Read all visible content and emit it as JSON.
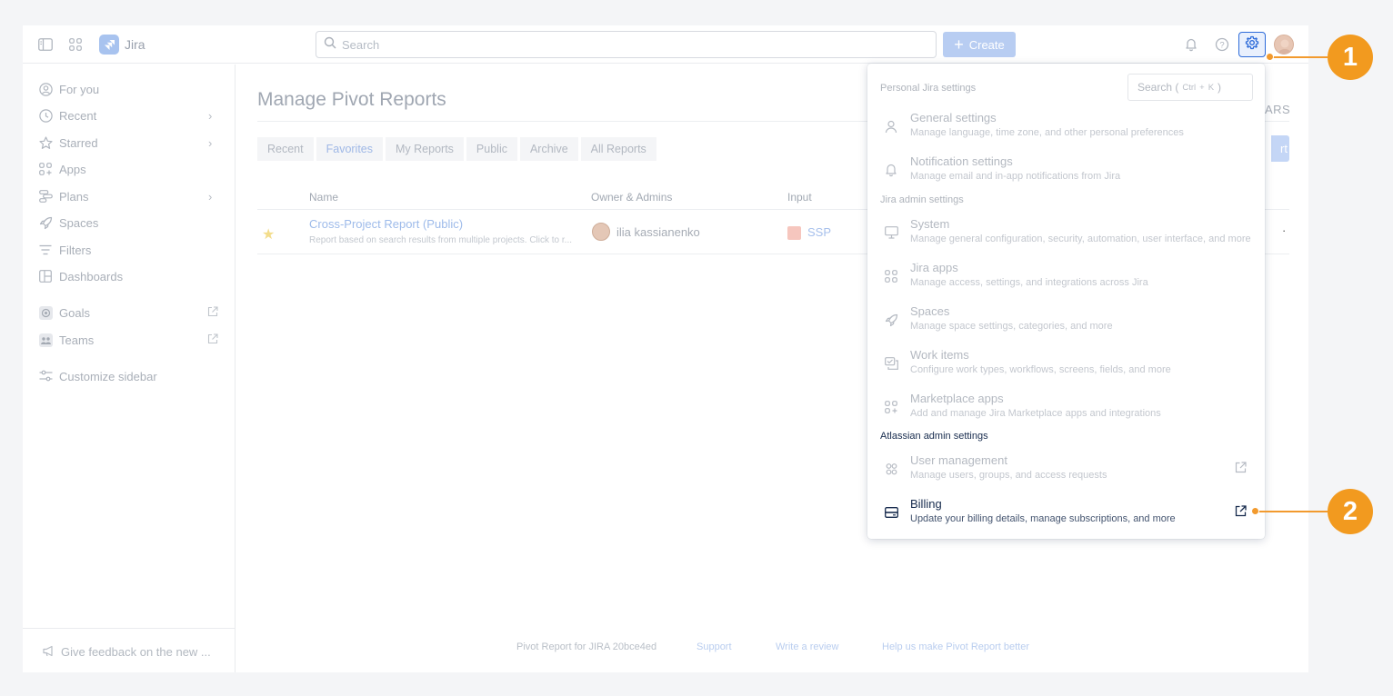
{
  "topbar": {
    "app_name": "Jira",
    "search_placeholder": "Search",
    "create_label": "Create"
  },
  "sidebar": {
    "items": [
      {
        "label": "For you",
        "icon": "user-circle-icon"
      },
      {
        "label": "Recent",
        "icon": "clock-icon"
      },
      {
        "label": "Starred",
        "icon": "star-icon"
      },
      {
        "label": "Apps",
        "icon": "apps-grid-icon"
      },
      {
        "label": "Plans",
        "icon": "plans-icon"
      },
      {
        "label": "Spaces",
        "icon": "rocket-icon"
      },
      {
        "label": "Filters",
        "icon": "filter-icon"
      },
      {
        "label": "Dashboards",
        "icon": "dashboard-icon"
      },
      {
        "label": "Goals",
        "icon": "goal-icon"
      },
      {
        "label": "Teams",
        "icon": "teams-icon"
      },
      {
        "label": "Customize sidebar",
        "icon": "sliders-icon"
      }
    ],
    "feedback_label": "Give feedback on the new ..."
  },
  "main": {
    "title": "Manage Pivot Reports",
    "right_fragment": "ARS",
    "right_button_fragment": "rt",
    "tabs": [
      "Recent",
      "Favorites",
      "My Reports",
      "Public",
      "Archive",
      "All Reports"
    ],
    "active_tab": "Favorites",
    "columns": [
      "Name",
      "Owner & Admins",
      "Input"
    ],
    "row": {
      "name": "Cross-Project Report (Public)",
      "description": "Report based on search results from multiple projects. Click to r...",
      "owner": "ilia kassianenko",
      "input": "SSP",
      "more": "·"
    },
    "footer": {
      "version": "Pivot Report for JIRA 20bce4ed",
      "support": "Support",
      "review": "Write a review",
      "help": "Help us make Pivot Report better"
    }
  },
  "settings_panel": {
    "search_label": "Search (",
    "search_k1": "Ctrl",
    "search_plus": "+",
    "search_k2": "K",
    "search_close": ")",
    "personal_heading": "Personal Jira settings",
    "jira_admin_heading": "Jira admin settings",
    "atlassian_heading": "Atlassian admin settings",
    "items": {
      "general": {
        "title": "General settings",
        "desc": "Manage language, time zone, and other personal preferences"
      },
      "notification": {
        "title": "Notification settings",
        "desc": "Manage email and in-app notifications from Jira"
      },
      "system": {
        "title": "System",
        "desc": "Manage general configuration, security, automation, user interface, and more"
      },
      "jira_apps": {
        "title": "Jira apps",
        "desc": "Manage access, settings, and integrations across Jira"
      },
      "spaces": {
        "title": "Spaces",
        "desc": "Manage space settings, categories, and more"
      },
      "work_items": {
        "title": "Work items",
        "desc": "Configure work types, workflows, screens, fields, and more"
      },
      "marketplace": {
        "title": "Marketplace apps",
        "desc": "Add and manage Jira Marketplace apps and integrations"
      },
      "user_mgmt": {
        "title": "User management",
        "desc": "Manage users, groups, and access requests"
      },
      "billing": {
        "title": "Billing",
        "desc": "Update your billing details, manage subscriptions, and more"
      }
    }
  },
  "callouts": [
    "1",
    "2"
  ],
  "colors": {
    "accent": "#2d6bd9",
    "callout": "#f29a1f"
  }
}
